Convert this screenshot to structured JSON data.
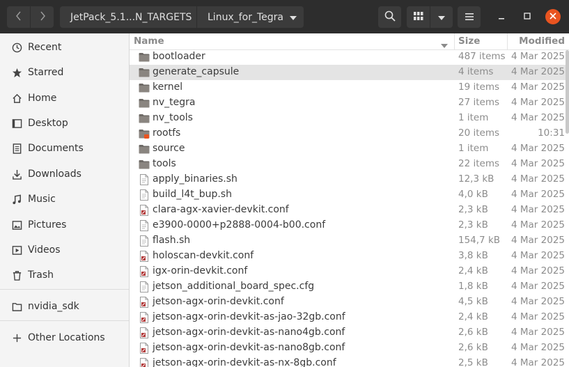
{
  "header": {
    "breadcrumb": [
      "JetPack_5.1...N_TARGETS",
      "Linux_for_Tegra"
    ],
    "accent_close": "#e95420"
  },
  "sidebar": {
    "items": [
      {
        "label": "Recent",
        "icon": "clock-icon"
      },
      {
        "label": "Starred",
        "icon": "star-icon"
      },
      {
        "label": "Home",
        "icon": "home-icon"
      },
      {
        "label": "Desktop",
        "icon": "desktop-icon"
      },
      {
        "label": "Documents",
        "icon": "document-icon"
      },
      {
        "label": "Downloads",
        "icon": "download-icon"
      },
      {
        "label": "Music",
        "icon": "music-icon"
      },
      {
        "label": "Pictures",
        "icon": "picture-icon"
      },
      {
        "label": "Videos",
        "icon": "video-icon"
      },
      {
        "label": "Trash",
        "icon": "trash-icon"
      },
      {
        "label": "nvidia_sdk",
        "icon": "folder-icon"
      },
      {
        "label": "Other Locations",
        "icon": "plus-icon"
      }
    ]
  },
  "columns": {
    "name": "Name",
    "size": "Size",
    "modified": "Modified"
  },
  "files": [
    {
      "name": "bootloader",
      "size": "487 items",
      "modified": "4 Mar 2025",
      "type": "folder"
    },
    {
      "name": "generate_capsule",
      "size": "4 items",
      "modified": "4 Mar 2025",
      "type": "folder",
      "selected": true
    },
    {
      "name": "kernel",
      "size": "19 items",
      "modified": "4 Mar 2025",
      "type": "folder"
    },
    {
      "name": "nv_tegra",
      "size": "27 items",
      "modified": "4 Mar 2025",
      "type": "folder"
    },
    {
      "name": "nv_tools",
      "size": "1 item",
      "modified": "4 Mar 2025",
      "type": "folder"
    },
    {
      "name": "rootfs",
      "size": "20 items",
      "modified": "10:31",
      "type": "folder-locked"
    },
    {
      "name": "source",
      "size": "1 item",
      "modified": "4 Mar 2025",
      "type": "folder"
    },
    {
      "name": "tools",
      "size": "22 items",
      "modified": "4 Mar 2025",
      "type": "folder"
    },
    {
      "name": "apply_binaries.sh",
      "size": "12,3 kB",
      "modified": "4 Mar 2025",
      "type": "script"
    },
    {
      "name": "build_l4t_bup.sh",
      "size": "4,0 kB",
      "modified": "4 Mar 2025",
      "type": "script"
    },
    {
      "name": "clara-agx-xavier-devkit.conf",
      "size": "2,3 kB",
      "modified": "4 Mar 2025",
      "type": "config"
    },
    {
      "name": "e3900-0000+p2888-0004-b00.conf",
      "size": "2,3 kB",
      "modified": "4 Mar 2025",
      "type": "script"
    },
    {
      "name": "flash.sh",
      "size": "154,7 kB",
      "modified": "4 Mar 2025",
      "type": "script"
    },
    {
      "name": "holoscan-devkit.conf",
      "size": "3,8 kB",
      "modified": "4 Mar 2025",
      "type": "config"
    },
    {
      "name": "igx-orin-devkit.conf",
      "size": "2,4 kB",
      "modified": "4 Mar 2025",
      "type": "config"
    },
    {
      "name": "jetson_additional_board_spec.cfg",
      "size": "1,8 kB",
      "modified": "4 Mar 2025",
      "type": "script"
    },
    {
      "name": "jetson-agx-orin-devkit.conf",
      "size": "4,5 kB",
      "modified": "4 Mar 2025",
      "type": "config"
    },
    {
      "name": "jetson-agx-orin-devkit-as-jao-32gb.conf",
      "size": "2,4 kB",
      "modified": "4 Mar 2025",
      "type": "config"
    },
    {
      "name": "jetson-agx-orin-devkit-as-nano4gb.conf",
      "size": "2,6 kB",
      "modified": "4 Mar 2025",
      "type": "config"
    },
    {
      "name": "jetson-agx-orin-devkit-as-nano8gb.conf",
      "size": "2,6 kB",
      "modified": "4 Mar 2025",
      "type": "config"
    },
    {
      "name": "jetson-agx-orin-devkit-as-nx-8gb.conf",
      "size": "2,5 kB",
      "modified": "4 Mar 2025",
      "type": "config"
    }
  ]
}
